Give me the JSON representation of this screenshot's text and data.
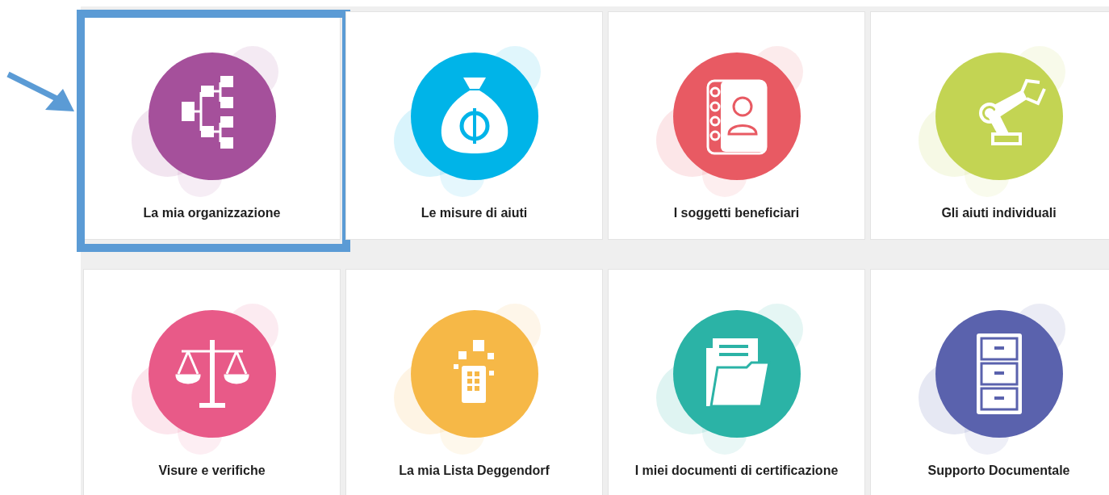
{
  "rows": [
    {
      "cards": [
        {
          "title": "La mia organizzazione",
          "kind": "org",
          "color": "#a5509b",
          "selected": true
        },
        {
          "title": "Le misure di aiuti",
          "kind": "money",
          "color": "#00b4e8",
          "selected": false
        },
        {
          "title": "I soggetti beneficiari",
          "kind": "contacts",
          "color": "#e85a63",
          "selected": false
        },
        {
          "title": "Gli aiuti individuali",
          "kind": "robot",
          "color": "#c3d453",
          "selected": false
        }
      ]
    },
    {
      "cards": [
        {
          "title": "Visure e verifiche",
          "kind": "scales",
          "color": "#e85a88",
          "selected": false
        },
        {
          "title": "La mia Lista Deggendorf",
          "kind": "tablet",
          "color": "#f6b847",
          "selected": false
        },
        {
          "title": "I miei documenti di certificazione",
          "kind": "folder",
          "color": "#2bb3a6",
          "selected": false
        },
        {
          "title": "Supporto Documentale",
          "kind": "cabinet",
          "color": "#5a62ad",
          "selected": false
        }
      ]
    }
  ]
}
